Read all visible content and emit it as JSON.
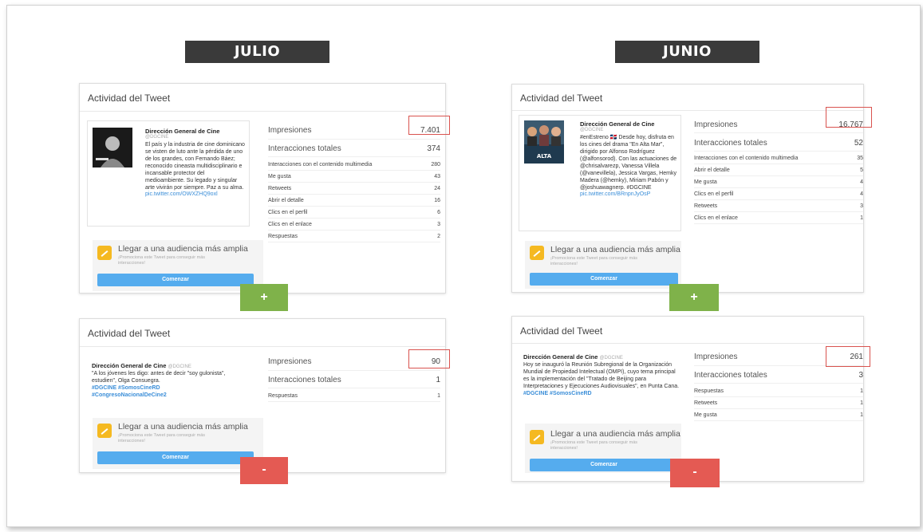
{
  "julio": {
    "banner": "JULIO",
    "card1": {
      "title": "Actividad del Tweet",
      "tweet": {
        "author": "Dirección General de Cine",
        "handle": "@DGCINE",
        "text": "El país y la industria de cine dominicano se visten de luto ante la pérdida de uno de los grandes, con Fernando Báez; reconocido cineasta multidisciplinario e incansable protector del medioambiente. Su legado y singular arte vivirán por siempre. Paz a su alma.",
        "link": "pic.twitter.com/OWXZHQ9oxl"
      },
      "impressions_label": "Impresiones",
      "impressions_value": "7.401",
      "total_label": "Interacciones totales",
      "total_value": "374",
      "metrics": [
        {
          "label": "Interacciones con el contenido multimedia",
          "value": "280"
        },
        {
          "label": "Me gusta",
          "value": "43"
        },
        {
          "label": "Retweets",
          "value": "24"
        },
        {
          "label": "Abrir el detalle",
          "value": "16"
        },
        {
          "label": "Clics en el perfil",
          "value": "6"
        },
        {
          "label": "Clics en el enlace",
          "value": "3"
        },
        {
          "label": "Respuestas",
          "value": "2"
        }
      ],
      "promo_title": "Llegar a una audiencia más amplia",
      "promo_sub": "¡Promociona este Tweet para conseguir más interacciones!",
      "promo_button": "Comenzar",
      "badge": "+"
    },
    "card2": {
      "title": "Actividad del Tweet",
      "tweet": {
        "author": "Dirección General de Cine",
        "handle": "@DGCINE",
        "text": "\"A los jóvenes les digo: antes de decir \"soy gulonista\", estudien\", Olga Consuegra.",
        "tags1": "#DGCINE #SomosCineRD",
        "tags2": "#CongresoNacionalDeCine2"
      },
      "impressions_label": "Impresiones",
      "impressions_value": "90",
      "total_label": "Interacciones totales",
      "total_value": "1",
      "metrics": [
        {
          "label": "Respuestas",
          "value": "1"
        }
      ],
      "promo_title": "Llegar a una audiencia más amplia",
      "promo_sub": "¡Promociona este Tweet para conseguir más interacciones!",
      "promo_button": "Comenzar",
      "badge": "-"
    }
  },
  "junio": {
    "banner": "JUNIO",
    "card1": {
      "title": "Actividad del Tweet",
      "tweet": {
        "author": "Dirección General de Cine",
        "handle": "@DGCINE",
        "text": "#enEstreno 🇩🇴 Desde hoy, disfruta en los cines del drama \"En Alta Mar\", dirigido por Alfonso Rodríguez (@alfonsorod). Con las actuaciones de @chrisalvarezp, Vanessa Villela (@vanevillela), Jessica Vargas, Hemky Madera (@hemky), Miriam Pabón y @joshuawagnerp. #DGCINE",
        "link": "pic.twitter.com/BRnpnJyOsP"
      },
      "impressions_label": "Impresiones",
      "impressions_value": "16.767",
      "total_label": "Interacciones totales",
      "total_value": "52",
      "metrics": [
        {
          "label": "Interacciones con el contenido multimedia",
          "value": "35"
        },
        {
          "label": "Abrir el detalle",
          "value": "5"
        },
        {
          "label": "Me gusta",
          "value": "4"
        },
        {
          "label": "Clics en el perfil",
          "value": "4"
        },
        {
          "label": "Retweets",
          "value": "3"
        },
        {
          "label": "Clics en el enlace",
          "value": "1"
        }
      ],
      "promo_title": "Llegar a una audiencia más amplia",
      "promo_sub": "¡Promociona este Tweet para conseguir más interacciones!",
      "promo_button": "Comenzar",
      "badge": "+"
    },
    "card2": {
      "title": "Actividad del Tweet",
      "tweet": {
        "author": "Dirección General de Cine",
        "handle": "@DGCINE",
        "text": "Hoy se inauguró la Reunión Subregional de la Organización Mundial de Propiedad Intelectual (OMPI), cuyo tema principal es la implementación del \"Tratado de Beijing para Interpretaciones y Ejecuciones Audiovisuales\", en Punta Cana.",
        "tags1": "#DGCINE #SomosCineRD"
      },
      "impressions_label": "Impresiones",
      "impressions_value": "261",
      "total_label": "Interacciones totales",
      "total_value": "3",
      "metrics": [
        {
          "label": "Respuestas",
          "value": "1"
        },
        {
          "label": "Retweets",
          "value": "1"
        },
        {
          "label": "Me gusta",
          "value": "1"
        }
      ],
      "promo_title": "Llegar a una audiencia más amplia",
      "promo_sub": "¡Promociona este Tweet para conseguir más interacciones!",
      "promo_button": "Comenzar",
      "badge": "-"
    }
  }
}
